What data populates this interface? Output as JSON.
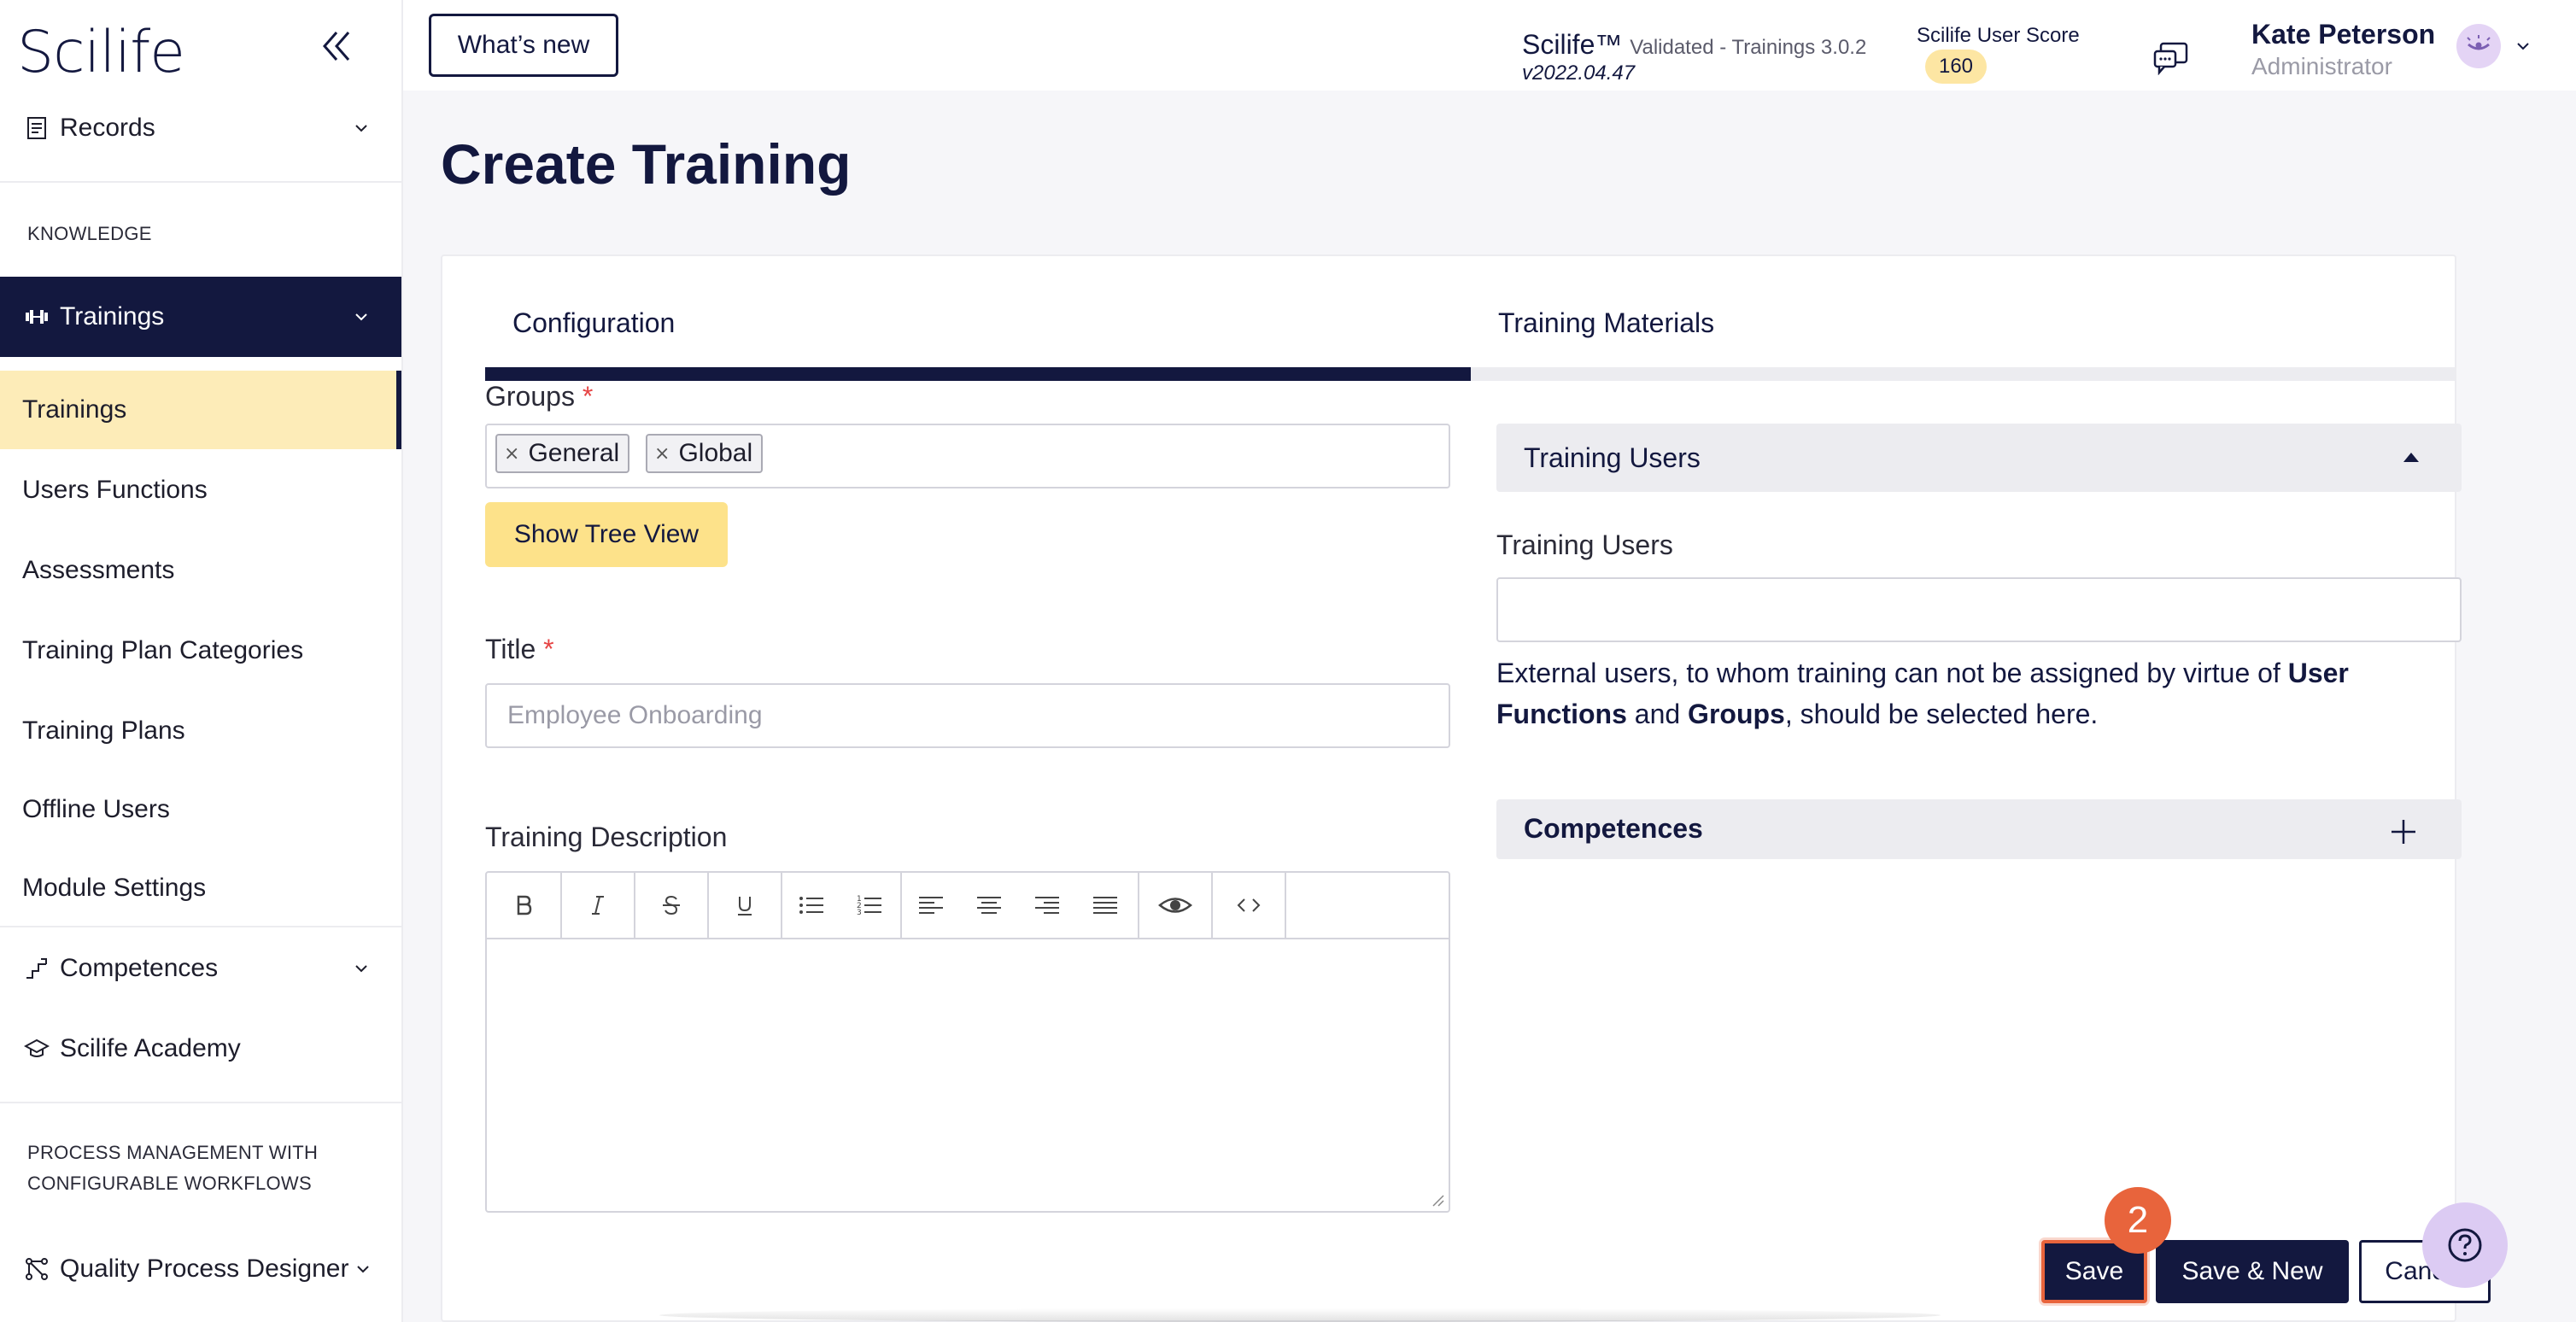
{
  "app": {
    "logo_text": "Scilife"
  },
  "topbar": {
    "whats_new_label": "What’s new",
    "product": "Scilife™",
    "product_detail": "Validated - Trainings 3.0.2",
    "version": "v2022.04.47",
    "score_label": "Scilife User Score",
    "score_value": "160",
    "user_name": "Kate Peterson",
    "user_role": "Administrator"
  },
  "sidebar": {
    "records_label": "Records",
    "section_knowledge": "KNOWLEDGE",
    "trainings_group_label": "Trainings",
    "sub_items": [
      "Trainings",
      "Users Functions",
      "Assessments",
      "Training Plan Categories",
      "Training Plans",
      "Offline Users",
      "Module Settings"
    ],
    "competences_label": "Competences",
    "academy_label": "Scilife Academy",
    "section_process_line1": "PROCESS MANAGEMENT WITH",
    "section_process_line2": "CONFIGURABLE WORKFLOWS",
    "qpd_label": "Quality Process Designer"
  },
  "page": {
    "title": "Create Training",
    "tabs": [
      "Configuration",
      "Training Materials"
    ],
    "groups_label": "Groups",
    "required_mark": "*",
    "group_chips": [
      "General",
      "Global"
    ],
    "chip_remove": "×",
    "tree_view_label": "Show Tree View",
    "title_label": "Title",
    "title_placeholder": "Employee Onboarding",
    "description_label": "Training Description",
    "training_users_section": "Training Users",
    "training_users_label": "Training Users",
    "help_part1": "External users, to whom training can not be assigned by virtue of ",
    "help_bold1": "User Functions",
    "help_part2": " and ",
    "help_bold2": "Groups",
    "help_part3": ", should be selected here.",
    "competences_section": "Competences"
  },
  "actions": {
    "save_label": "Save",
    "save_new_label": "Save & New",
    "cancel_label": "Cancel",
    "step_number": "2"
  },
  "colors": {
    "navy": "#13183f",
    "highlight_yellow": "#fdecb8",
    "button_yellow": "#fde28a",
    "step_orange": "#e8643c",
    "help_purple": "#dccbf3"
  }
}
